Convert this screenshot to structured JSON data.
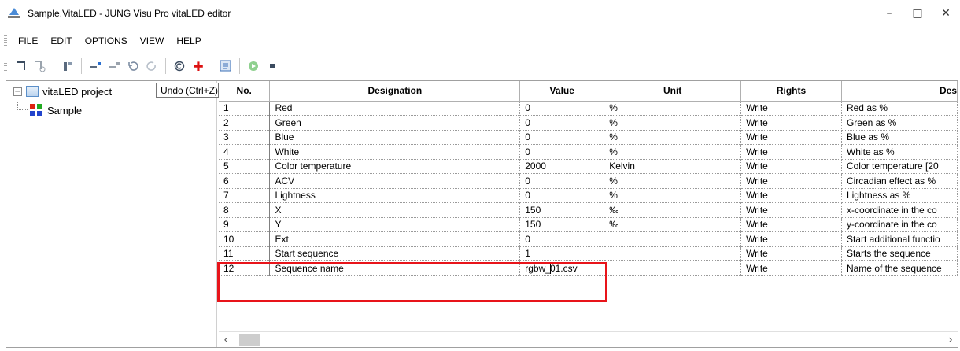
{
  "window": {
    "title": "Sample.VitaLED - JUNG Visu Pro vitaLED editor",
    "minimize": "–",
    "maximize": "□",
    "close": "✕"
  },
  "menu": [
    "FILE",
    "EDIT",
    "OPTIONS",
    "VIEW",
    "HELP"
  ],
  "tree": {
    "root": "vitaLED project",
    "child": "Sample",
    "expander": "−"
  },
  "tooltip": "Undo (Ctrl+Z)",
  "table": {
    "headers": [
      "No.",
      "Designation",
      "Value",
      "Unit",
      "Rights",
      "Des"
    ],
    "rows": [
      [
        "1",
        "Red",
        "0",
        "%",
        "Write",
        "Red as %"
      ],
      [
        "2",
        "Green",
        "0",
        "%",
        "Write",
        "Green as %"
      ],
      [
        "3",
        "Blue",
        "0",
        "%",
        "Write",
        "Blue as %"
      ],
      [
        "4",
        "White",
        "0",
        "%",
        "Write",
        "White as %"
      ],
      [
        "5",
        "Color temperature",
        "2000",
        "Kelvin",
        "Write",
        "Color temperature [20"
      ],
      [
        "6",
        "ACV",
        "0",
        "%",
        "Write",
        "Circadian effect as %"
      ],
      [
        "7",
        "Lightness",
        "0",
        "%",
        "Write",
        "Lightness as %"
      ],
      [
        "8",
        "X",
        "150",
        "‰",
        "Write",
        "x-coordinate in the co"
      ],
      [
        "9",
        "Y",
        "150",
        "‰",
        "Write",
        "y-coordinate in the co"
      ],
      [
        "10",
        "Ext",
        "0",
        "",
        "Write",
        "Start additional functio"
      ],
      [
        "11",
        "Start sequence",
        "1",
        "",
        "Write",
        "Starts the sequence"
      ],
      [
        "12",
        "Sequence name",
        "rgbw_01.csv",
        "",
        "Write",
        "Name of the sequence"
      ]
    ],
    "edit_value_before_caret": "rgbw_",
    "edit_value_after_caret": "01.csv"
  },
  "scroll": {
    "left": "‹",
    "right": "›"
  },
  "colors": {
    "highlight": "#e8141a"
  }
}
